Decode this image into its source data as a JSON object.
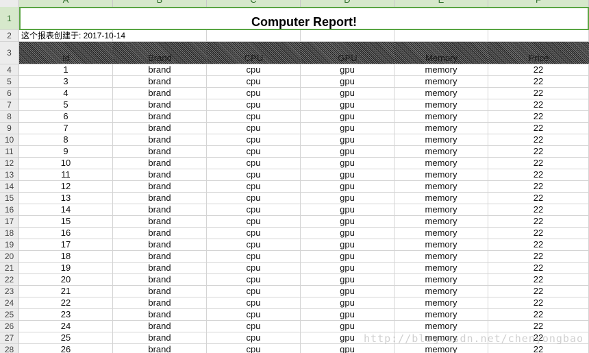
{
  "columns": [
    "A",
    "B",
    "C",
    "D",
    "E",
    "F"
  ],
  "title": "Computer Report!",
  "created_note": "这个报表创建于: 2017-10-14",
  "headers": [
    "Id",
    "Brand",
    "CPU",
    "GPU",
    "Memory",
    "Price"
  ],
  "rows": [
    {
      "rownum": "4",
      "cells": [
        "1",
        "brand",
        "cpu",
        "gpu",
        "memory",
        "22"
      ]
    },
    {
      "rownum": "5",
      "cells": [
        "3",
        "brand",
        "cpu",
        "gpu",
        "memory",
        "22"
      ]
    },
    {
      "rownum": "6",
      "cells": [
        "4",
        "brand",
        "cpu",
        "gpu",
        "memory",
        "22"
      ]
    },
    {
      "rownum": "7",
      "cells": [
        "5",
        "brand",
        "cpu",
        "gpu",
        "memory",
        "22"
      ]
    },
    {
      "rownum": "8",
      "cells": [
        "6",
        "brand",
        "cpu",
        "gpu",
        "memory",
        "22"
      ]
    },
    {
      "rownum": "9",
      "cells": [
        "7",
        "brand",
        "cpu",
        "gpu",
        "memory",
        "22"
      ]
    },
    {
      "rownum": "10",
      "cells": [
        "8",
        "brand",
        "cpu",
        "gpu",
        "memory",
        "22"
      ]
    },
    {
      "rownum": "11",
      "cells": [
        "9",
        "brand",
        "cpu",
        "gpu",
        "memory",
        "22"
      ]
    },
    {
      "rownum": "12",
      "cells": [
        "10",
        "brand",
        "cpu",
        "gpu",
        "memory",
        "22"
      ]
    },
    {
      "rownum": "13",
      "cells": [
        "11",
        "brand",
        "cpu",
        "gpu",
        "memory",
        "22"
      ]
    },
    {
      "rownum": "14",
      "cells": [
        "12",
        "brand",
        "cpu",
        "gpu",
        "memory",
        "22"
      ]
    },
    {
      "rownum": "15",
      "cells": [
        "13",
        "brand",
        "cpu",
        "gpu",
        "memory",
        "22"
      ]
    },
    {
      "rownum": "16",
      "cells": [
        "14",
        "brand",
        "cpu",
        "gpu",
        "memory",
        "22"
      ]
    },
    {
      "rownum": "17",
      "cells": [
        "15",
        "brand",
        "cpu",
        "gpu",
        "memory",
        "22"
      ]
    },
    {
      "rownum": "18",
      "cells": [
        "16",
        "brand",
        "cpu",
        "gpu",
        "memory",
        "22"
      ]
    },
    {
      "rownum": "19",
      "cells": [
        "17",
        "brand",
        "cpu",
        "gpu",
        "memory",
        "22"
      ]
    },
    {
      "rownum": "20",
      "cells": [
        "18",
        "brand",
        "cpu",
        "gpu",
        "memory",
        "22"
      ]
    },
    {
      "rownum": "21",
      "cells": [
        "19",
        "brand",
        "cpu",
        "gpu",
        "memory",
        "22"
      ]
    },
    {
      "rownum": "22",
      "cells": [
        "20",
        "brand",
        "cpu",
        "gpu",
        "memory",
        "22"
      ]
    },
    {
      "rownum": "23",
      "cells": [
        "21",
        "brand",
        "cpu",
        "gpu",
        "memory",
        "22"
      ]
    },
    {
      "rownum": "24",
      "cells": [
        "22",
        "brand",
        "cpu",
        "gpu",
        "memory",
        "22"
      ]
    },
    {
      "rownum": "25",
      "cells": [
        "23",
        "brand",
        "cpu",
        "gpu",
        "memory",
        "22"
      ]
    },
    {
      "rownum": "26",
      "cells": [
        "24",
        "brand",
        "cpu",
        "gpu",
        "memory",
        "22"
      ]
    },
    {
      "rownum": "27",
      "cells": [
        "25",
        "brand",
        "cpu",
        "gpu",
        "memory",
        "22"
      ]
    },
    {
      "rownum": "28",
      "cells": [
        "26",
        "brand",
        "cpu",
        "gpu",
        "memory",
        "22"
      ]
    }
  ],
  "watermark": "http://blog.csdn.net/chenyongbao",
  "colors": {
    "selection_border": "#5aa543",
    "selection_header": "#d6e8cb",
    "header_fill": "#444444"
  }
}
